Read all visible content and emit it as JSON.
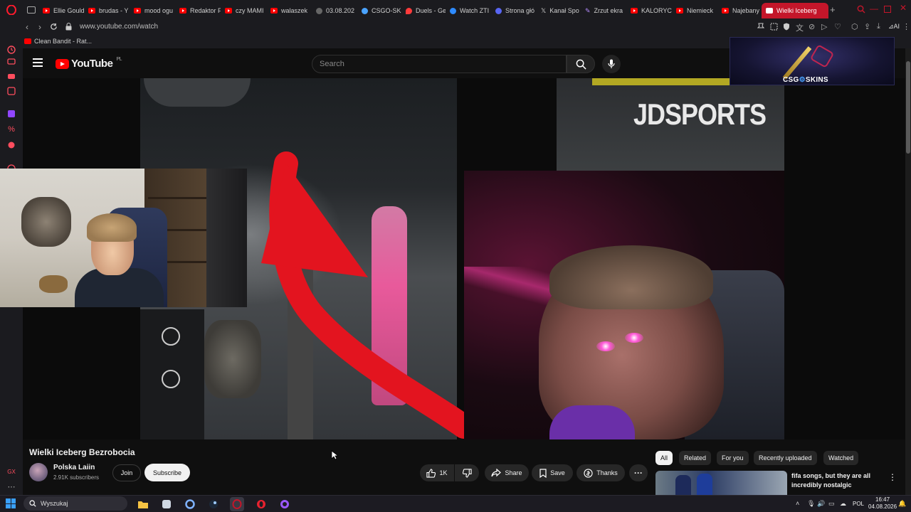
{
  "browser": {
    "tabs": [
      {
        "label": "Ellie Gould",
        "favicon": "youtube-icon"
      },
      {
        "label": "brudas - Y",
        "favicon": "youtube-icon"
      },
      {
        "label": "mood ogu",
        "favicon": "youtube-icon"
      },
      {
        "label": "Redaktor F",
        "favicon": "youtube-icon"
      },
      {
        "label": "czy MAMI",
        "favicon": "youtube-icon"
      },
      {
        "label": "walaszek",
        "favicon": "youtube-icon"
      },
      {
        "label": "03.08.202",
        "favicon": "generic-icon"
      },
      {
        "label": "CSGO-SKI",
        "favicon": "csgo-icon"
      },
      {
        "label": "Duels - Ge",
        "favicon": "map-pin-icon"
      },
      {
        "label": "Watch ZTI",
        "favicon": "watch-icon"
      },
      {
        "label": "Strona głó",
        "favicon": "discord-icon"
      },
      {
        "label": "Kanał Spo",
        "favicon": "x-icon"
      },
      {
        "label": "Zrzut ekra",
        "favicon": "pen-icon"
      },
      {
        "label": "KALORYC",
        "favicon": "youtube-icon"
      },
      {
        "label": "Niemieck",
        "favicon": "youtube-icon"
      },
      {
        "label": "Najebany",
        "favicon": "youtube-icon"
      },
      {
        "label": "Wielki Iceberg",
        "favicon": "youtube-icon",
        "active": true
      }
    ],
    "url": "www.youtube.com/watch",
    "bookmark": "Clean Bandit - Rat...",
    "toolbar_ai": "AI"
  },
  "youtube": {
    "logo_text": "YouTube",
    "region": "PL",
    "search_placeholder": "Search"
  },
  "ad": {
    "brand": "CSG",
    "brand_suffix": "SKINS"
  },
  "video": {
    "overlay_text": "JDSPORTS",
    "title": "Wielki Iceberg Bezrobocia",
    "channel": "Polska Laiin",
    "subscribers": "2.91K subscribers",
    "join_label": "Join",
    "subscribe_label": "Subscribe",
    "likes": "1K",
    "share_label": "Share",
    "save_label": "Save",
    "thanks_label": "Thanks"
  },
  "chips": [
    "All",
    "Related",
    "For you",
    "Recently uploaded",
    "Watched"
  ],
  "recommendation": {
    "title": "fifa songs, but they are all incredibly nostalgic"
  },
  "taskbar": {
    "search_label": "Wyszukaj",
    "lang": "POL",
    "time": "16:47",
    "date": "04.08.2026"
  },
  "colors": {
    "accent": "#ff0000",
    "active_tab": "#c4162a",
    "background": "#0f0f0f"
  }
}
